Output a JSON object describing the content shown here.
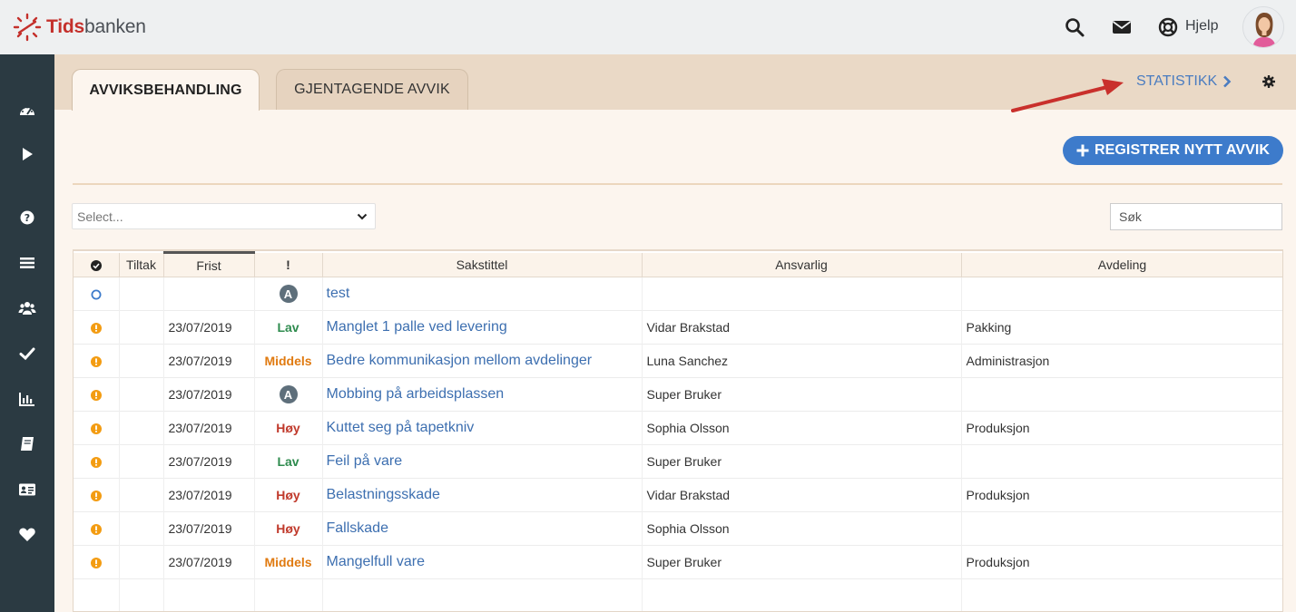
{
  "app": {
    "logo_bold": "Tids",
    "logo_rest": "banken",
    "help_label": "Hjelp"
  },
  "tabs": [
    {
      "label": "AVVIKSBEHANDLING",
      "active": true
    },
    {
      "label": "GJENTAGENDE AVVIK",
      "active": false
    }
  ],
  "statistics_link": "STATISTIKK",
  "register_button": "REGISTRER NYTT AVVIK",
  "filter": {
    "select_placeholder": "Select..."
  },
  "search": {
    "placeholder": "Søk"
  },
  "colors": {
    "brand_red": "#c4302b",
    "accent_blue": "#3d7bcb",
    "sidebar": "#2b3a42",
    "status_orange": "#f39c12"
  },
  "sidebar_icons": [
    "dashboard-icon",
    "play-icon",
    "question-icon",
    "list-icon",
    "users-icon",
    "check-icon",
    "bar-chart-icon",
    "book-icon",
    "id-card-icon",
    "heart-icon"
  ],
  "table": {
    "headers": {
      "status": "",
      "tiltak": "Tiltak",
      "frist": "Frist",
      "priority": "!",
      "title": "Sakstittel",
      "responsible": "Ansvarlig",
      "department": "Avdeling"
    },
    "rows": [
      {
        "status": "circle",
        "tiltak": "",
        "frist": "",
        "priority": "A",
        "priority_type": "badge",
        "title": "test",
        "responsible": "",
        "department": ""
      },
      {
        "status": "warning",
        "tiltak": "",
        "frist": "23/07/2019",
        "priority": "Lav",
        "priority_type": "lav",
        "title": "Manglet 1 palle ved levering",
        "responsible": "Vidar Brakstad",
        "department": "Pakking"
      },
      {
        "status": "warning",
        "tiltak": "",
        "frist": "23/07/2019",
        "priority": "Middels",
        "priority_type": "middels",
        "title": "Bedre kommunikasjon mellom avdelinger",
        "responsible": "Luna Sanchez",
        "department": "Administrasjon"
      },
      {
        "status": "warning",
        "tiltak": "",
        "frist": "23/07/2019",
        "priority": "A",
        "priority_type": "badge",
        "title": "Mobbing på arbeidsplassen",
        "responsible": "Super Bruker",
        "department": ""
      },
      {
        "status": "warning",
        "tiltak": "",
        "frist": "23/07/2019",
        "priority": "Høy",
        "priority_type": "hoy",
        "title": "Kuttet seg på tapetkniv",
        "responsible": "Sophia Olsson",
        "department": "Produksjon"
      },
      {
        "status": "warning",
        "tiltak": "",
        "frist": "23/07/2019",
        "priority": "Lav",
        "priority_type": "lav",
        "title": "Feil på vare",
        "responsible": "Super Bruker",
        "department": ""
      },
      {
        "status": "warning",
        "tiltak": "",
        "frist": "23/07/2019",
        "priority": "Høy",
        "priority_type": "hoy",
        "title": "Belastningsskade",
        "responsible": "Vidar Brakstad",
        "department": "Produksjon"
      },
      {
        "status": "warning",
        "tiltak": "",
        "frist": "23/07/2019",
        "priority": "Høy",
        "priority_type": "hoy",
        "title": "Fallskade",
        "responsible": "Sophia Olsson",
        "department": ""
      },
      {
        "status": "warning",
        "tiltak": "",
        "frist": "23/07/2019",
        "priority": "Middels",
        "priority_type": "middels",
        "title": "Mangelfull vare",
        "responsible": "Super Bruker",
        "department": "Produksjon"
      }
    ]
  }
}
